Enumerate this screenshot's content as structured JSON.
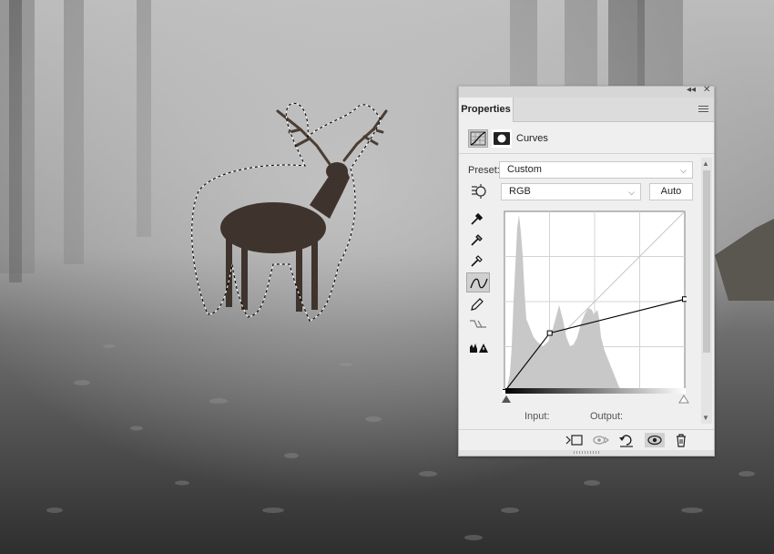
{
  "panel": {
    "title_controls": [
      "◂◂",
      "✕"
    ],
    "tab_label": "Properties",
    "header_title": "Curves",
    "preset_label": "Preset:",
    "preset_value": "Custom",
    "channel_value": "RGB",
    "auto_label": "Auto",
    "input_label": "Input:",
    "output_label": "Output:"
  },
  "tools": [
    {
      "name": "hand-adjust-icon"
    },
    {
      "name": "black-point-eyedropper-icon"
    },
    {
      "name": "gray-point-eyedropper-icon"
    },
    {
      "name": "white-point-eyedropper-icon"
    },
    {
      "name": "curve-points-icon"
    },
    {
      "name": "pencil-icon"
    },
    {
      "name": "smooth-curve-icon"
    },
    {
      "name": "clipping-warning-icon"
    }
  ],
  "footer_buttons": [
    "clip-to-layer-icon",
    "view-previous-icon",
    "reset-icon",
    "visibility-eye-icon",
    "trash-icon"
  ],
  "curve": {
    "points": [
      [
        0,
        0
      ],
      [
        64,
        83
      ],
      [
        255,
        131
      ]
    ],
    "range": [
      0,
      255
    ]
  },
  "colors": {
    "panel_bg": "#efefef",
    "histogram": "#c8c8c8",
    "curve": "#000000"
  }
}
